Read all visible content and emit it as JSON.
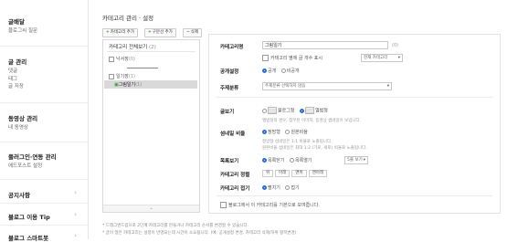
{
  "sidebar": {
    "sections": [
      {
        "title": "글배달",
        "items": [
          "블로그씨 질문"
        ]
      },
      {
        "title": "글 관리",
        "items": [
          "댓글",
          "태그",
          "글 저장"
        ]
      },
      {
        "title": "동영상 관리",
        "items": [
          "내 동영상"
        ]
      },
      {
        "title": "플러그인·연동 관리",
        "items": [
          "애드포스트 설정"
        ]
      },
      {
        "title": "공지사항",
        "items": []
      },
      {
        "title": "블로그 이용 Tip",
        "items": []
      },
      {
        "title": "블로그 스마트봇",
        "items": []
      }
    ]
  },
  "page": {
    "title": "카테고리 관리 · 설정"
  },
  "toolbar": {
    "add_category": "카테고리 추가",
    "add_divider": "구분선 추가",
    "delete": "삭제"
  },
  "tree": {
    "root": "카테고리 전체보기",
    "root_count": "(2)",
    "items": [
      {
        "label": "낙서장",
        "count": "(0)"
      },
      {
        "label": "일기장",
        "count": "(1)"
      },
      {
        "label": "그림일기",
        "count": "(1)"
      }
    ]
  },
  "form": {
    "name_label": "카테고리명",
    "name_value": "그림일기",
    "name_count": "(0)",
    "show_count_label": "카테고리 옆에 글 개수 표시",
    "show_count_select": "현재 카테고리",
    "visibility_label": "공개설정",
    "visibility_options": [
      "공개",
      "비공개"
    ],
    "topic_label": "주제분류",
    "topic_placeholder": "주제분류 선택하지 않음",
    "view_label": "글보기",
    "view_options": [
      "블로그형",
      "앨범형"
    ],
    "view_hint": "앨범형의 경우, 첨부된 이미지, 동영상 썸네일이 보입니다.",
    "thumb_label": "섬네일 비율",
    "thumb_options": [
      "정방형",
      "원본비율"
    ],
    "thumb_hint1": "정방형 섬네일은 1:1 비율로 노출됩니다.",
    "thumb_hint2": "원본비율 섬네일은 최대 1:2 (가로, 세로) 비율로 노출됩니다.",
    "list_label": "목록보기",
    "list_options": [
      "목록닫기",
      "목록열기"
    ],
    "list_select": "5줄 보기",
    "layout_label": "카테고리 정렬",
    "layout_buttons": [
      "위",
      "아래",
      "맨위",
      "맨아래"
    ],
    "fold_label": "카테고리 접기",
    "fold_options": [
      "펼치기",
      "접기"
    ],
    "default_label": "블로그에서 이 카테고리를 기본으로 보여줍니다."
  },
  "footer": {
    "note1": "* 드래그앤드랍으로 2단계 카테고리를 만들거나 카테고리 순서를 변경할 수 있습니다.",
    "note2": "* 글이 많은 카테고리는 설정이 반영되는데 시간이 소요됩니다. (예: 공개설정 변경, 카테고리 삭제/하위 항목변경)"
  }
}
